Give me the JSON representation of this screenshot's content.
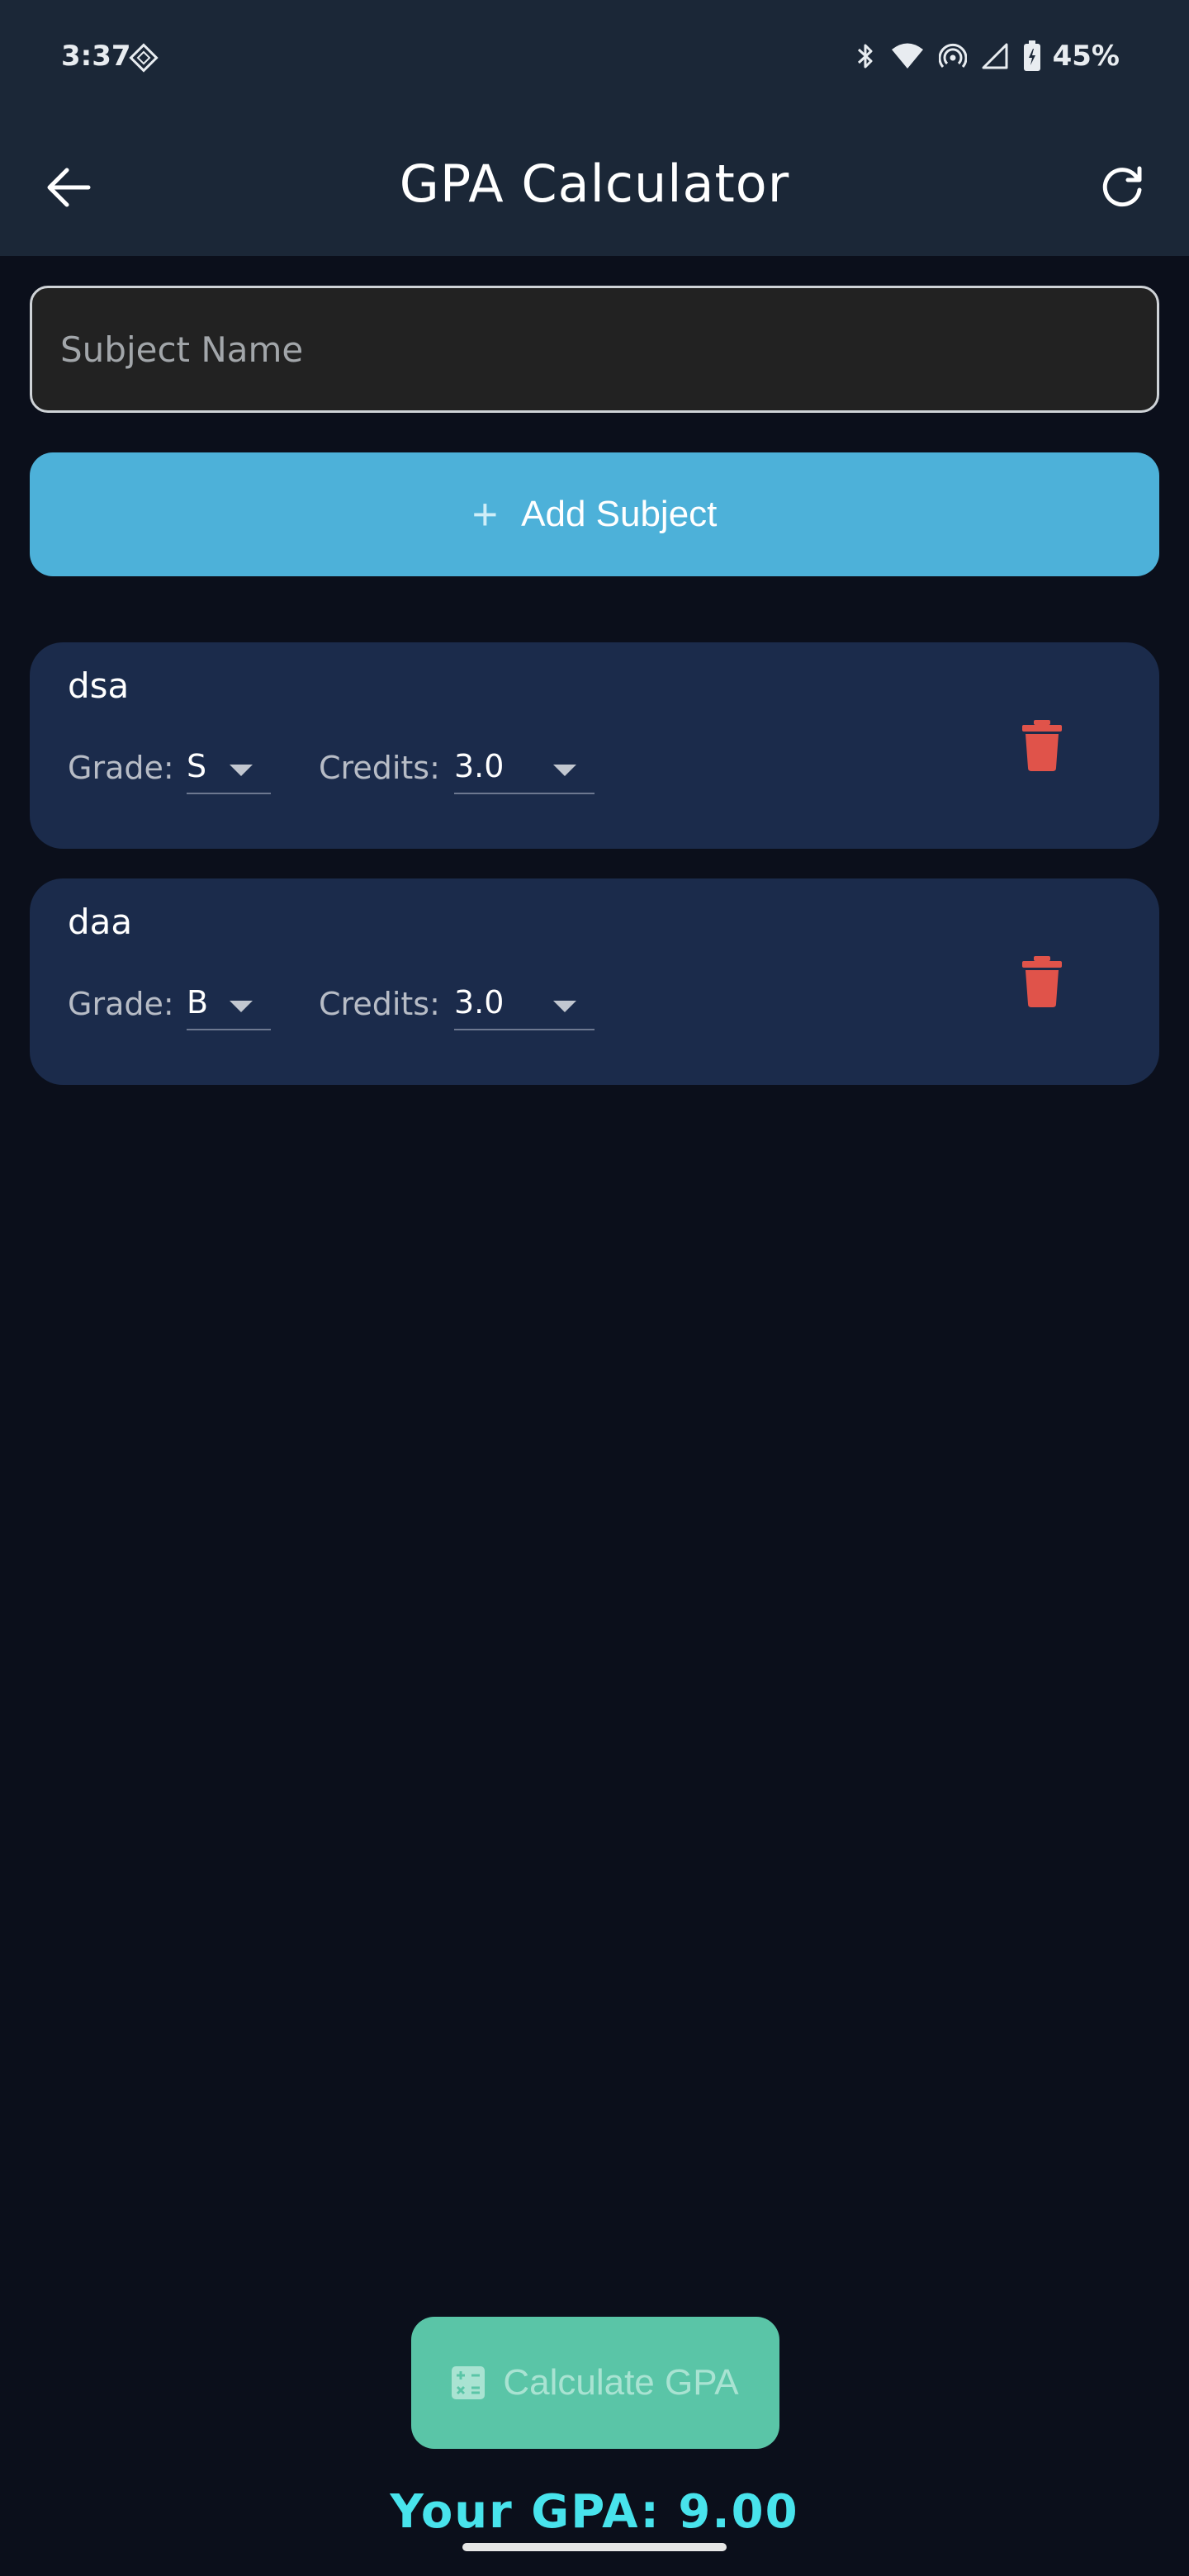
{
  "status_bar": {
    "time": "3:37",
    "battery": "45%"
  },
  "app_bar": {
    "title": "GPA Calculator"
  },
  "subject_input": {
    "placeholder": "Subject Name",
    "value": ""
  },
  "add_button": {
    "label": "Add Subject"
  },
  "subjects": [
    {
      "name": "dsa",
      "grade_label": "Grade:",
      "grade": "S",
      "credits_label": "Credits:",
      "credits": "3.0"
    },
    {
      "name": "daa",
      "grade_label": "Grade:",
      "grade": "B",
      "credits_label": "Credits:",
      "credits": "3.0"
    }
  ],
  "calculate_button": {
    "label": "Calculate GPA"
  },
  "result": {
    "text": "Your GPA: 9.00"
  },
  "colors": {
    "background": "#0b0f1b",
    "app_bar": "#1b2737",
    "card": "#1b2b4b",
    "add_button": "#4db1d9",
    "calculate_button": "#5ac5a7",
    "gpa_text": "#48e3ec",
    "delete_icon": "#e0534a"
  },
  "icons": {
    "back": "arrow-left-icon",
    "refresh": "refresh-icon",
    "add": "plus-icon",
    "delete": "trash-icon",
    "calculate": "calculator-icon"
  }
}
